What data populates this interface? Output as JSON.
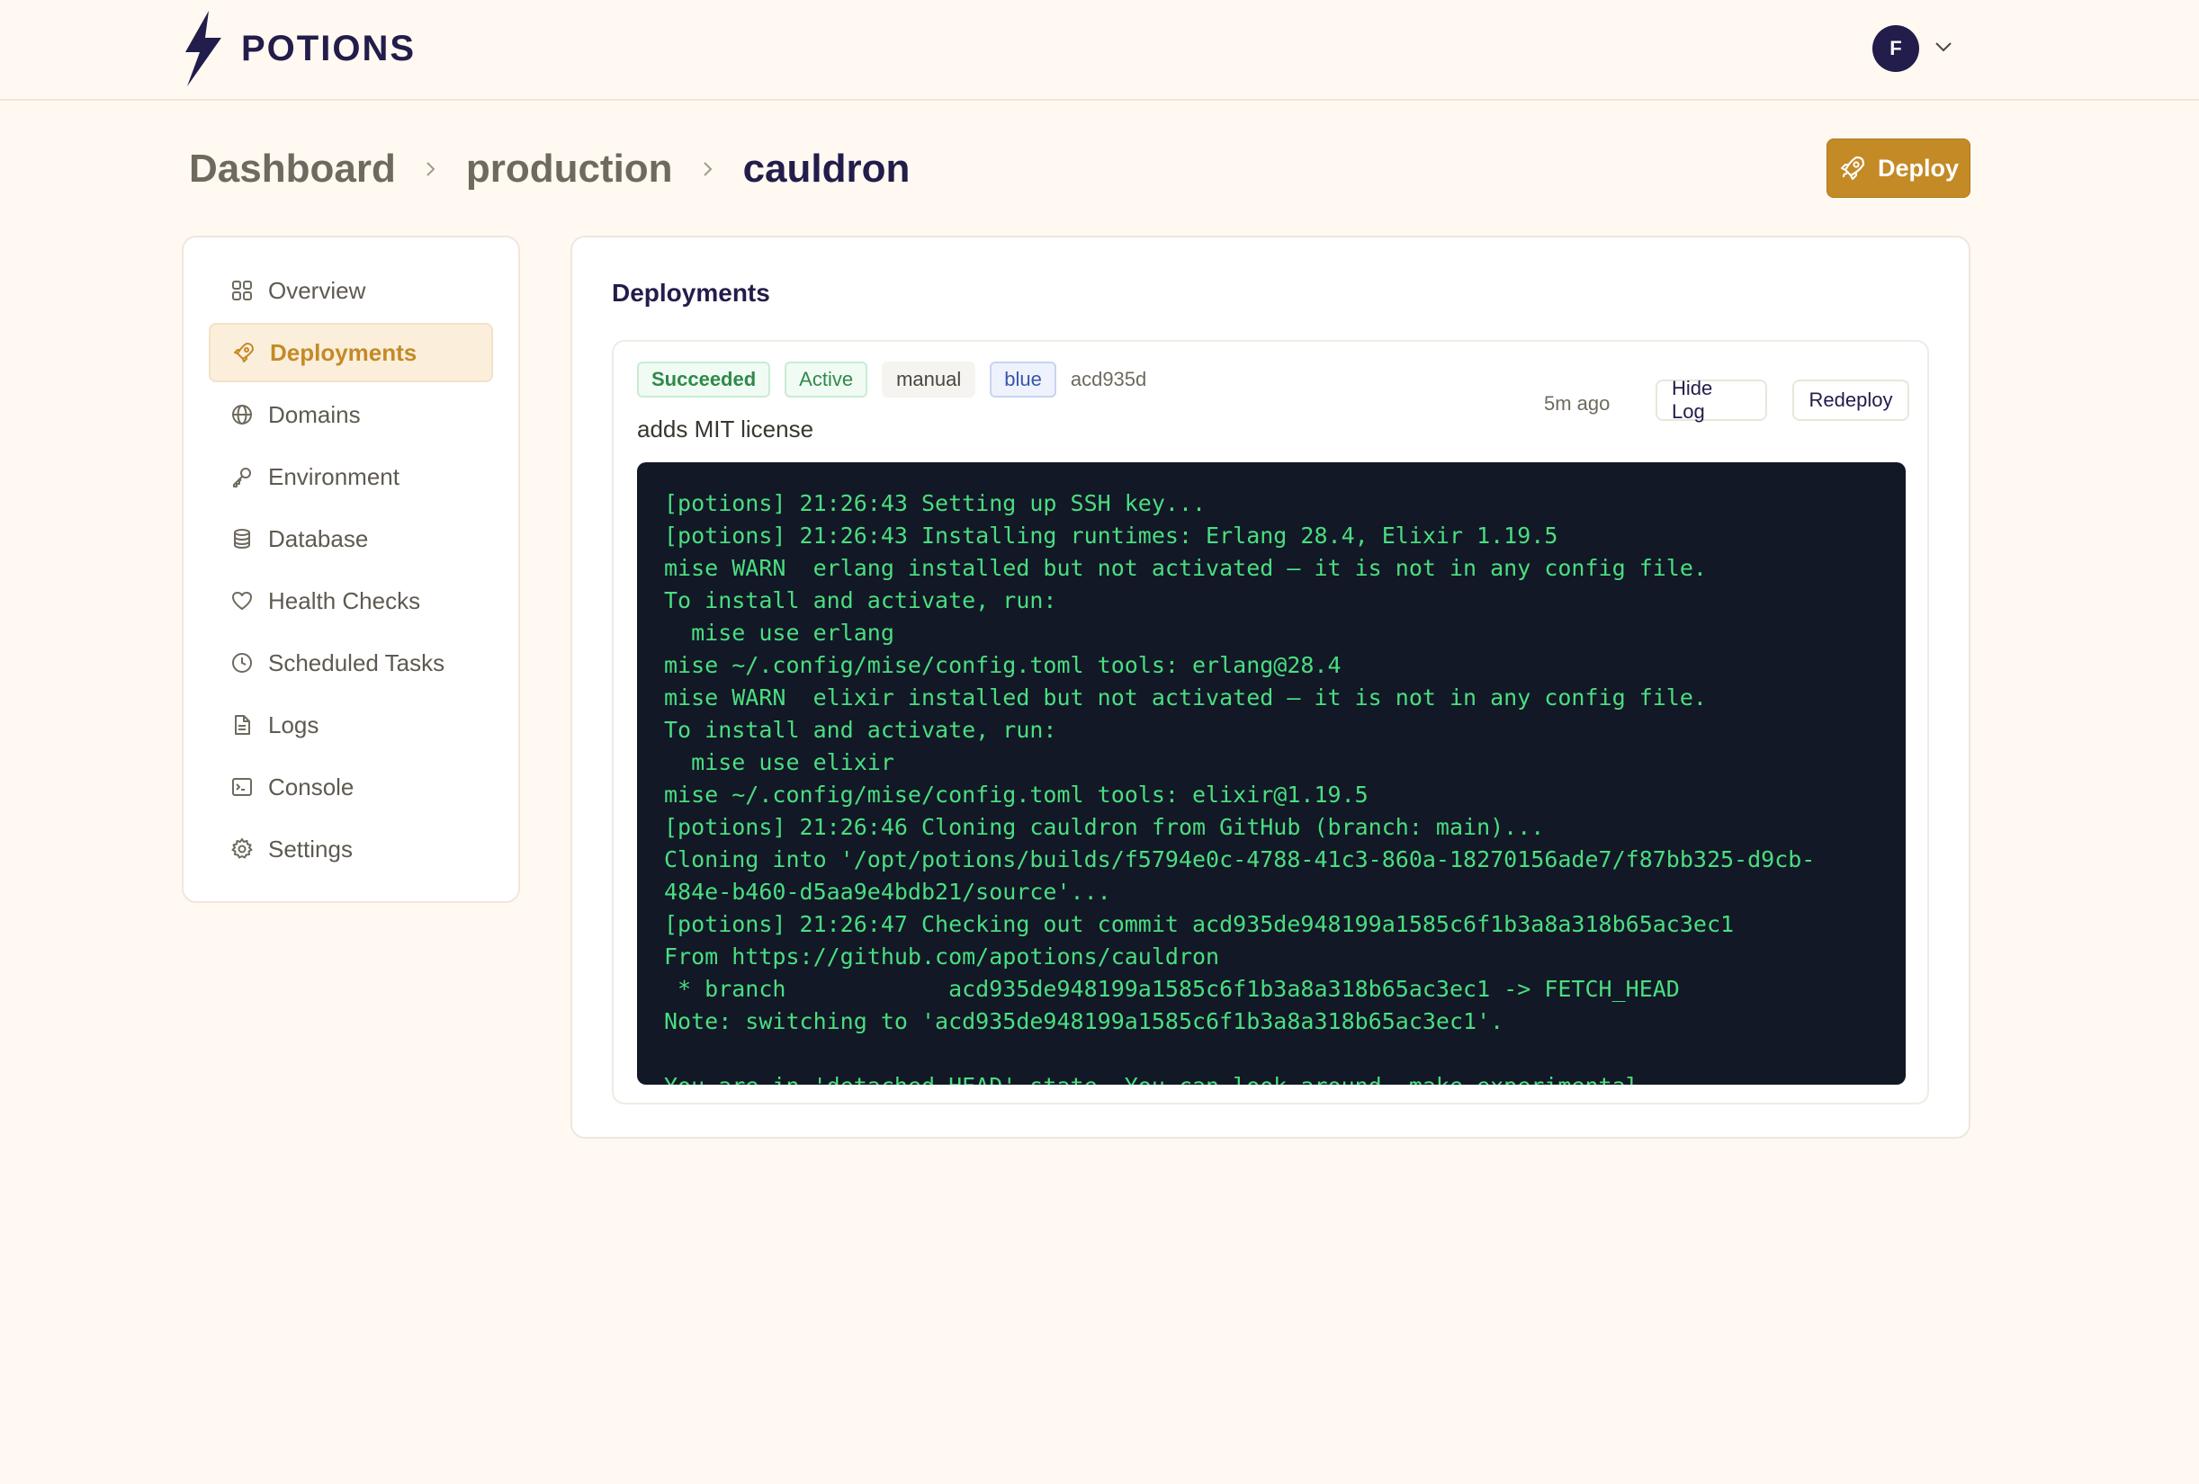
{
  "header": {
    "brand": "POTIONS",
    "user_initial": "F"
  },
  "breadcrumb": [
    "Dashboard",
    "production",
    "cauldron"
  ],
  "actions": {
    "deploy_label": "Deploy"
  },
  "sidebar": {
    "items": [
      {
        "label": "Overview",
        "icon": "grid-icon"
      },
      {
        "label": "Deployments",
        "icon": "rocket-icon",
        "active": true
      },
      {
        "label": "Domains",
        "icon": "globe-icon"
      },
      {
        "label": "Environment",
        "icon": "key-icon"
      },
      {
        "label": "Database",
        "icon": "database-icon"
      },
      {
        "label": "Health Checks",
        "icon": "heart-icon"
      },
      {
        "label": "Scheduled Tasks",
        "icon": "clock-icon"
      },
      {
        "label": "Logs",
        "icon": "file-icon"
      },
      {
        "label": "Console",
        "icon": "terminal-icon"
      },
      {
        "label": "Settings",
        "icon": "gear-icon"
      }
    ]
  },
  "main": {
    "title": "Deployments",
    "deployment": {
      "status": "Succeeded",
      "state": "Active",
      "trigger": "manual",
      "slot": "blue",
      "sha": "acd935d",
      "message": "adds MIT license",
      "time_ago": "5m ago",
      "hide_log_label": "Hide Log",
      "redeploy_label": "Redeploy",
      "log_lines": [
        "[potions] 21:26:43 Setting up SSH key...",
        "[potions] 21:26:43 Installing runtimes: Erlang 28.4, Elixir 1.19.5",
        "mise WARN  erlang installed but not activated — it is not in any config file.",
        "To install and activate, run:",
        "  mise use erlang",
        "mise ~/.config/mise/config.toml tools: erlang@28.4",
        "mise WARN  elixir installed but not activated — it is not in any config file.",
        "To install and activate, run:",
        "  mise use elixir",
        "mise ~/.config/mise/config.toml tools: elixir@1.19.5",
        "[potions] 21:26:46 Cloning cauldron from GitHub (branch: main)...",
        "Cloning into '/opt/potions/builds/f5794e0c-4788-41c3-860a-18270156ade7/f87bb325-d9cb-",
        "484e-b460-d5aa9e4bdb21/source'...",
        "[potions] 21:26:47 Checking out commit acd935de948199a1585c6f1b3a8a318b65ac3ec1",
        "From https://github.com/apotions/cauldron",
        " * branch            acd935de948199a1585c6f1b3a8a318b65ac3ec1 -> FETCH_HEAD",
        "Note: switching to 'acd935de948199a1585c6f1b3a8a318b65ac3ec1'.",
        "",
        "You are in 'detached HEAD' state. You can look around, make experimental"
      ]
    }
  },
  "colors": {
    "accent": "#c48a26",
    "brand_dark": "#221d4a",
    "log_bg": "#121826",
    "log_text": "#4ade80"
  }
}
